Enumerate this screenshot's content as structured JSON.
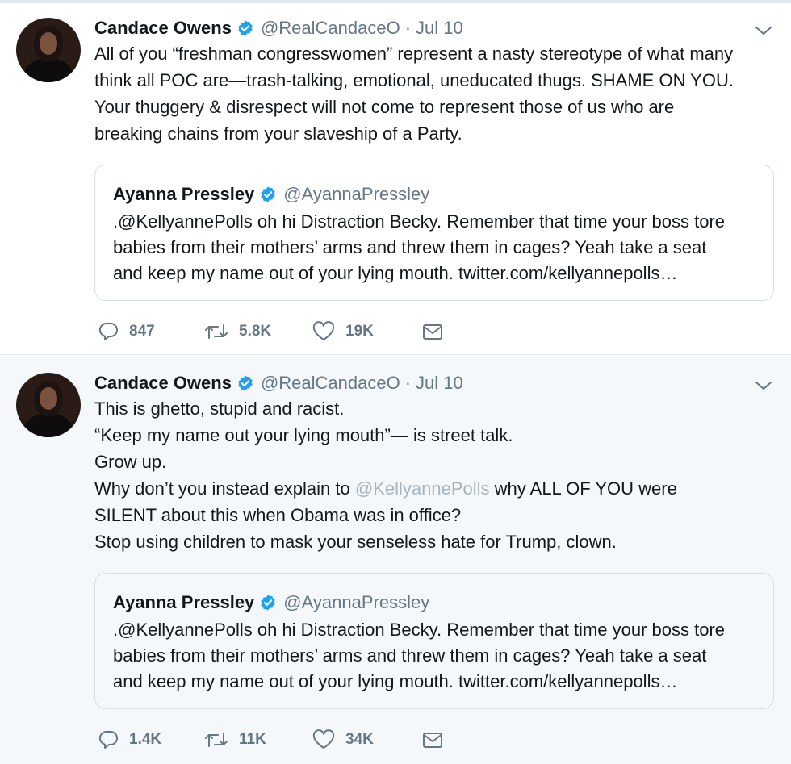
{
  "tweets": [
    {
      "author_name": "Candace Owens",
      "handle": "@RealCandaceO",
      "separator": "·",
      "date": "Jul 10",
      "text_lines": [
        "All of you “freshman congresswomen” represent a nasty stereotype of what many",
        "think all POC are—trash-talking, emotional, uneducated thugs. SHAME ON YOU.",
        "Your thuggery & disrespect will not come to represent those of us who are",
        "breaking chains from your slaveship of a Party."
      ],
      "quote": {
        "author_name": "Ayanna Pressley",
        "handle": "@AyannaPressley",
        "text_lines": [
          ".@KellyannePolls oh hi Distraction Becky. Remember that time your boss tore",
          "babies from their mothers’ arms and threw them in cages? Yeah take a seat",
          "and keep my name out of your lying mouth. twitter.com/kellyannepolls…"
        ]
      },
      "stats": {
        "replies": "847",
        "retweets": "5.8K",
        "likes": "19K"
      }
    },
    {
      "author_name": "Candace Owens",
      "handle": "@RealCandaceO",
      "separator": "·",
      "date": "Jul 10",
      "text_lines": [
        "This is ghetto, stupid and racist.",
        "“Keep my name out your lying mouth”— is street talk.",
        "Grow up."
      ],
      "text_line4": {
        "before": "Why don’t you instead explain to ",
        "mention": "@KellyannePolls",
        "after": " why ALL OF YOU were"
      },
      "text_lines_end": [
        "SILENT about this when Obama was in office?",
        "Stop using children to mask your senseless hate for Trump, clown."
      ],
      "quote": {
        "author_name": "Ayanna Pressley",
        "handle": "@AyannaPressley",
        "text_lines": [
          ".@KellyannePolls oh hi Distraction Becky. Remember that time your boss tore",
          "babies from their mothers’ arms and threw them in cages? Yeah take a seat",
          "and keep my name out of your lying mouth. twitter.com/kellyannepolls…"
        ]
      },
      "stats": {
        "replies": "1.4K",
        "retweets": "11K",
        "likes": "34K"
      }
    }
  ],
  "icons": {
    "verified": "verified-badge-icon",
    "menu": "chevron-down-icon",
    "reply": "reply-icon",
    "retweet": "retweet-icon",
    "like": "heart-icon",
    "dm": "envelope-icon"
  },
  "colors": {
    "verified": "#1da1f2",
    "secondary_text": "#657786",
    "mention": "#a7b4be",
    "background_alt": "#f5f8fa"
  }
}
